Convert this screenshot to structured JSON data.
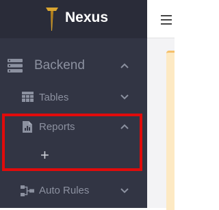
{
  "brand": {
    "name": "Nexus",
    "logo_icon": "trident-icon"
  },
  "sidebar": {
    "items": [
      {
        "label": "Backend",
        "icon": "server-stack-icon",
        "chevron": "chevron-up-icon",
        "expanded": true
      },
      {
        "label": "Tables",
        "icon": "table-icon",
        "chevron": "chevron-down-icon",
        "expanded": false
      },
      {
        "label": "Reports",
        "icon": "file-chart-icon",
        "chevron": "chevron-up-icon",
        "expanded": true
      },
      {
        "label": "Auto Rules",
        "icon": "sitemap-icon",
        "chevron": "chevron-down-icon",
        "expanded": false
      }
    ],
    "reports_add_symbol": "+"
  },
  "topbar": {
    "menu_icon": "hamburger-menu-icon"
  },
  "colors": {
    "sidebar_bg": "#323544",
    "brand_bg": "#2a2c39",
    "muted_text": "#8c91a0",
    "highlight_red": "#e10b0b",
    "logo_gold": "#d9a531",
    "card_accent": "#f5c06a"
  }
}
